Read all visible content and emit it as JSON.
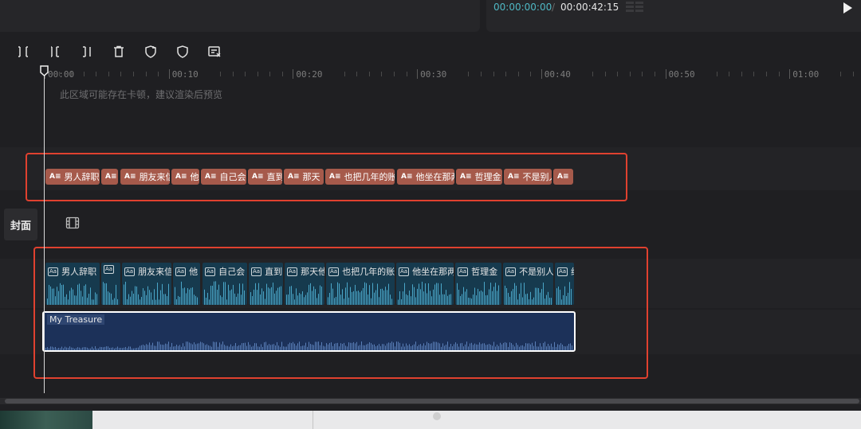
{
  "player": {
    "current_time": "00:00:00:00",
    "separator": "/",
    "total_time": "00:00:42:15"
  },
  "toolbar": {
    "tools": [
      "split-icon",
      "trim-left-icon",
      "trim-right-icon",
      "delete-icon",
      "freeze-icon",
      "mark-icon",
      "auto-caption-icon"
    ]
  },
  "ruler": {
    "labels": [
      "00:00",
      "00:10",
      "00:20",
      "00:30",
      "00:40",
      "00:50",
      "01:00"
    ]
  },
  "timeline": {
    "render_hint": "此区域可能存在卡顿，建议渲染后预览",
    "cover_label": "封面",
    "music_title": "My Treasure"
  },
  "text_track": {
    "icon": "A≡",
    "clips": [
      "男人辞职",
      "",
      "朋友来信",
      "他",
      "自己会",
      "直到",
      "那天",
      "也把几年的账",
      "他坐在那两",
      "哲理金",
      "不是别人",
      ""
    ]
  },
  "tts_track": {
    "icon": "Aa",
    "clips": [
      "男人辞职",
      "",
      "朋友来信",
      "他",
      "自己会",
      "直到",
      "那天他",
      "也把几年的账",
      "他坐在那两",
      "哲理金",
      "不是别人",
      "终"
    ]
  },
  "colors": {
    "accent_timecode": "#4fb8c4",
    "text_clip": "#a65a4b",
    "tts_clip": "#163a4e",
    "music_clip": "#1c3159",
    "highlight_box": "#e0412f"
  }
}
